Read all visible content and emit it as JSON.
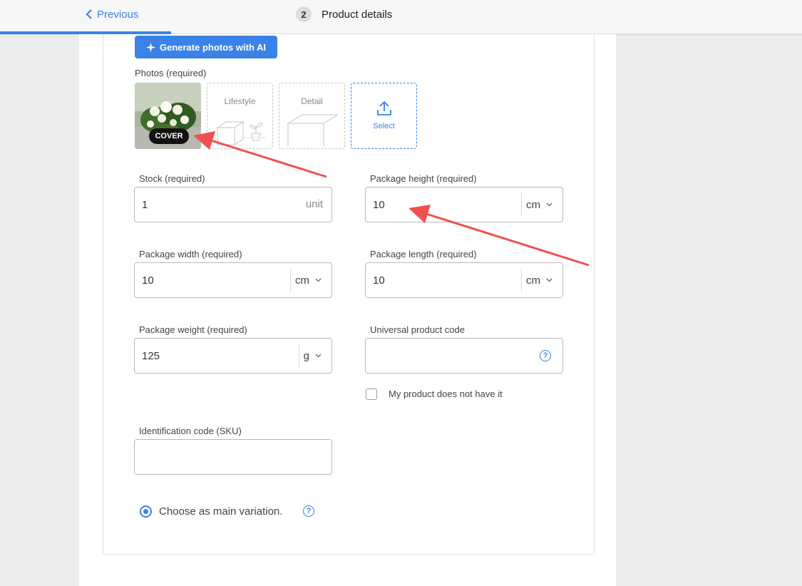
{
  "header": {
    "back_label": "Previous",
    "step_number": "2",
    "step_title": "Product details",
    "progress_fraction": 0.213
  },
  "ai_button": {
    "label": "Generate photos with AI",
    "icon": "sparkle-icon"
  },
  "photos": {
    "label": "Photos (required)",
    "cover_badge": "COVER",
    "lifestyle_label": "Lifestyle",
    "detail_label": "Detail",
    "select_label": "Select"
  },
  "fields": {
    "stock": {
      "label": "Stock (required)",
      "value": "1",
      "unit": "unit"
    },
    "package_height": {
      "label": "Package height (required)",
      "value": "10",
      "unit": "cm"
    },
    "package_width": {
      "label": "Package width (required)",
      "value": "10",
      "unit": "cm"
    },
    "package_length": {
      "label": "Package length (required)",
      "value": "10",
      "unit": "cm"
    },
    "package_weight": {
      "label": "Package weight (required)",
      "value": "125",
      "unit": "g"
    },
    "upc": {
      "label": "Universal product code",
      "value": "",
      "no_code_label": "My product does not have it",
      "no_code_checked": false
    },
    "sku": {
      "label": "Identification code (SKU)",
      "value": ""
    }
  },
  "main_variation": {
    "label": "Choose as main variation.",
    "selected": true
  },
  "colors": {
    "accent": "#3a82e8",
    "annotation_arrow": "#f0504f"
  }
}
